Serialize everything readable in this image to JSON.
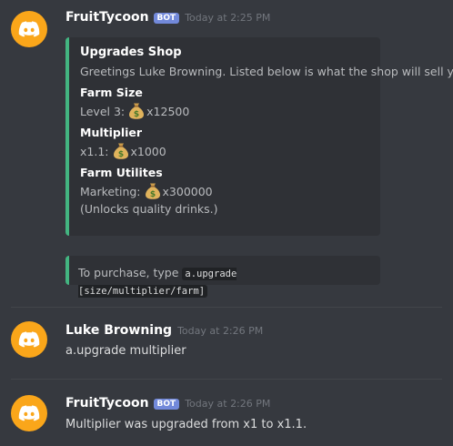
{
  "messages": [
    {
      "username": "FruitTycoon",
      "bot_tag": "BOT",
      "timestamp": "Today at 2:25 PM",
      "embed": {
        "color": "#43b581",
        "title": "Upgrades Shop",
        "description": "Greetings Luke Browning. Listed below is what the shop will sell you.",
        "fields": [
          {
            "name": "Farm Size",
            "value_prefix": "Level 3:",
            "value_amount": "x12500",
            "note": ""
          },
          {
            "name": "Multiplier",
            "value_prefix": "x1.1:",
            "value_amount": "x1000",
            "note": ""
          },
          {
            "name": "Farm Utilites",
            "value_prefix": "Marketing:",
            "value_amount": "x300000",
            "note": "(Unlocks quality drinks.)"
          }
        ]
      },
      "embed2": {
        "text": "To purchase, type",
        "code": "a.upgrade [size/multiplier/farm]"
      }
    },
    {
      "username": "Luke Browning",
      "timestamp": "Today at 2:26 PM",
      "content": "a.upgrade multiplier"
    },
    {
      "username": "FruitTycoon",
      "bot_tag": "BOT",
      "timestamp": "Today at 2:26 PM",
      "content": "Multiplier was upgraded from x1 to x1.1."
    }
  ],
  "icons": {
    "avatar": "discord-logo-icon",
    "currency": "money-bag-icon"
  },
  "colors": {
    "background": "#36393f",
    "avatar": "#faa61a",
    "bot_tag": "#7289da",
    "embed_bg": "#2f3136"
  }
}
